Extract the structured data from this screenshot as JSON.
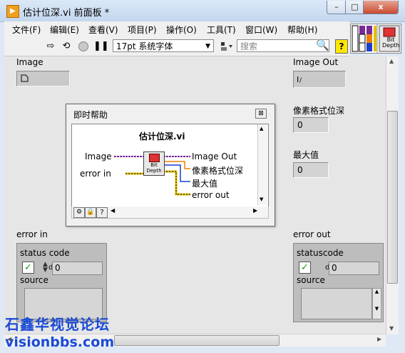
{
  "window": {
    "title": "估计位深.vi 前面板 *",
    "min_label": "–",
    "max_label": "□",
    "close_label": "x"
  },
  "menu": [
    "文件(F)",
    "编辑(E)",
    "查看(V)",
    "项目(P)",
    "操作(O)",
    "工具(T)",
    "窗口(W)",
    "帮助(H)"
  ],
  "toolbar": {
    "font": "17pt 系统字体",
    "search_placeholder": "搜索",
    "help": "?"
  },
  "connector_icon": {
    "line1": "Bit",
    "line2": "Depth"
  },
  "controls": {
    "image_label": "Image",
    "image_out_label": "Image Out",
    "pixel_format_label": "像素格式位深",
    "pixel_format_value": "0",
    "max_label": "最大值",
    "max_value": "0",
    "error_in": {
      "label": "error in",
      "status_label": "status code",
      "code": "0",
      "source_label": "source",
      "d": "d"
    },
    "error_out": {
      "label": "error out",
      "status_label": "statuscode",
      "code": "0",
      "source_label": "source",
      "d": "d"
    }
  },
  "help_window": {
    "title": "即时帮助",
    "vi_name": "估计位深.vi",
    "inputs": [
      "Image",
      "error in"
    ],
    "outputs": [
      "Image Out",
      "像素格式位深",
      "最大值",
      "error out"
    ],
    "icon_line1": "Bit",
    "icon_line2": "Depth"
  },
  "watermark": {
    "line1": "石鑫华视觉论坛",
    "line2": "visionbbs.com"
  },
  "colors": {
    "accent": "#1a4bd6",
    "wire_image": "#7a2a9a",
    "wire_error": "#e0c000",
    "wire_num": "#f08000",
    "wire_int": "#1a3fd0"
  }
}
